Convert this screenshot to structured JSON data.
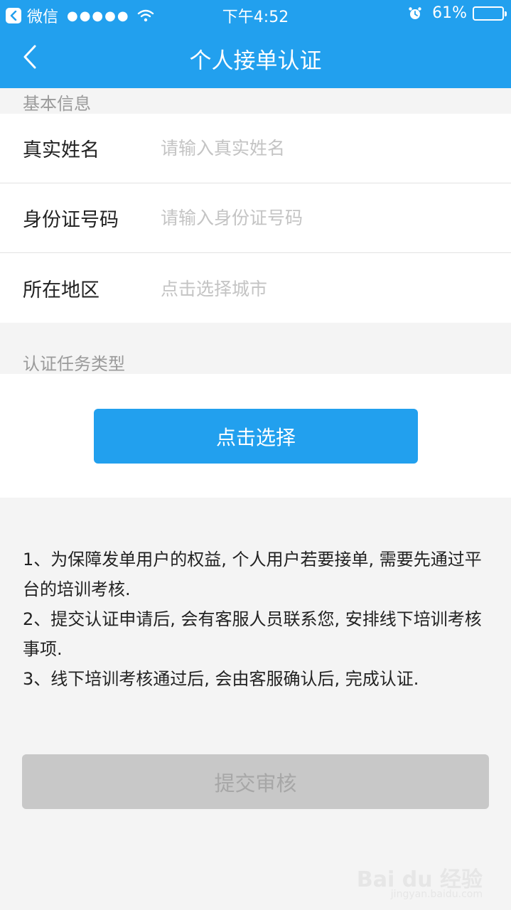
{
  "status_bar": {
    "app": "微信",
    "signal": "●●●●●",
    "time": "下午4:52",
    "battery": "61%",
    "battery_level": 0.61,
    "icons": [
      "back-app-icon",
      "wifi-icon",
      "alarm-icon",
      "battery-icon"
    ]
  },
  "nav": {
    "title": "个人接单认证",
    "back_icon": "chevron-left-icon"
  },
  "basic_info": {
    "section_label": "基本信息",
    "fields": [
      {
        "label": "真实姓名",
        "placeholder": "请输入真实姓名"
      },
      {
        "label": "身份证号码",
        "placeholder": "请输入身份证号码"
      },
      {
        "label": "所在地区",
        "placeholder": "点击选择城市"
      }
    ]
  },
  "task_type": {
    "section_label": "认证任务类型",
    "select_label": "点击选择"
  },
  "notes": [
    "1、为保障发单用户的权益, 个人用户若要接单, 需要先通过平台的培训考核.",
    "2、提交认证申请后, 会有客服人员联系您, 安排线下培训考核事项.",
    "3、线下培训考核通过后, 会由客服确认后, 完成认证."
  ],
  "submit_label": "提交审核",
  "colors": {
    "primary": "#22a0ee",
    "disabled": "#c8c8c8",
    "background": "#f4f4f4"
  },
  "watermark": {
    "brand": "Bai du 经验",
    "url": "jingyan.baidu.com"
  }
}
